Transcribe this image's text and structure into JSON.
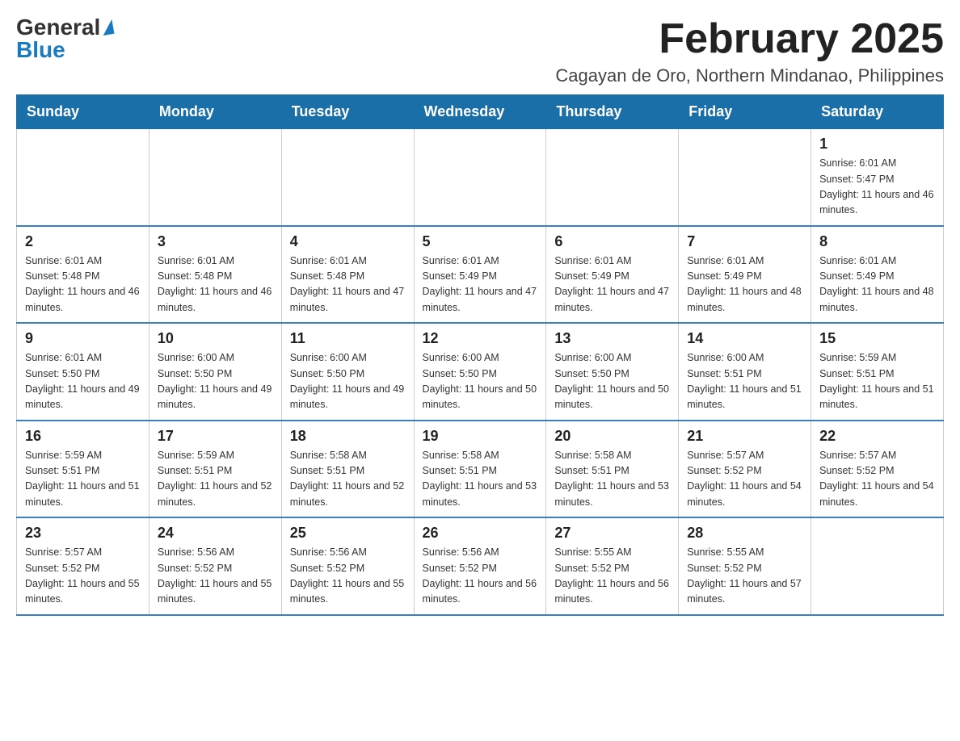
{
  "header": {
    "logo_general": "General",
    "logo_blue": "Blue",
    "month_title": "February 2025",
    "location": "Cagayan de Oro, Northern Mindanao, Philippines"
  },
  "days_of_week": [
    "Sunday",
    "Monday",
    "Tuesday",
    "Wednesday",
    "Thursday",
    "Friday",
    "Saturday"
  ],
  "weeks": [
    [
      {
        "day": "",
        "sunrise": "",
        "sunset": "",
        "daylight": ""
      },
      {
        "day": "",
        "sunrise": "",
        "sunset": "",
        "daylight": ""
      },
      {
        "day": "",
        "sunrise": "",
        "sunset": "",
        "daylight": ""
      },
      {
        "day": "",
        "sunrise": "",
        "sunset": "",
        "daylight": ""
      },
      {
        "day": "",
        "sunrise": "",
        "sunset": "",
        "daylight": ""
      },
      {
        "day": "",
        "sunrise": "",
        "sunset": "",
        "daylight": ""
      },
      {
        "day": "1",
        "sunrise": "Sunrise: 6:01 AM",
        "sunset": "Sunset: 5:47 PM",
        "daylight": "Daylight: 11 hours and 46 minutes."
      }
    ],
    [
      {
        "day": "2",
        "sunrise": "Sunrise: 6:01 AM",
        "sunset": "Sunset: 5:48 PM",
        "daylight": "Daylight: 11 hours and 46 minutes."
      },
      {
        "day": "3",
        "sunrise": "Sunrise: 6:01 AM",
        "sunset": "Sunset: 5:48 PM",
        "daylight": "Daylight: 11 hours and 46 minutes."
      },
      {
        "day": "4",
        "sunrise": "Sunrise: 6:01 AM",
        "sunset": "Sunset: 5:48 PM",
        "daylight": "Daylight: 11 hours and 47 minutes."
      },
      {
        "day": "5",
        "sunrise": "Sunrise: 6:01 AM",
        "sunset": "Sunset: 5:49 PM",
        "daylight": "Daylight: 11 hours and 47 minutes."
      },
      {
        "day": "6",
        "sunrise": "Sunrise: 6:01 AM",
        "sunset": "Sunset: 5:49 PM",
        "daylight": "Daylight: 11 hours and 47 minutes."
      },
      {
        "day": "7",
        "sunrise": "Sunrise: 6:01 AM",
        "sunset": "Sunset: 5:49 PM",
        "daylight": "Daylight: 11 hours and 48 minutes."
      },
      {
        "day": "8",
        "sunrise": "Sunrise: 6:01 AM",
        "sunset": "Sunset: 5:49 PM",
        "daylight": "Daylight: 11 hours and 48 minutes."
      }
    ],
    [
      {
        "day": "9",
        "sunrise": "Sunrise: 6:01 AM",
        "sunset": "Sunset: 5:50 PM",
        "daylight": "Daylight: 11 hours and 49 minutes."
      },
      {
        "day": "10",
        "sunrise": "Sunrise: 6:00 AM",
        "sunset": "Sunset: 5:50 PM",
        "daylight": "Daylight: 11 hours and 49 minutes."
      },
      {
        "day": "11",
        "sunrise": "Sunrise: 6:00 AM",
        "sunset": "Sunset: 5:50 PM",
        "daylight": "Daylight: 11 hours and 49 minutes."
      },
      {
        "day": "12",
        "sunrise": "Sunrise: 6:00 AM",
        "sunset": "Sunset: 5:50 PM",
        "daylight": "Daylight: 11 hours and 50 minutes."
      },
      {
        "day": "13",
        "sunrise": "Sunrise: 6:00 AM",
        "sunset": "Sunset: 5:50 PM",
        "daylight": "Daylight: 11 hours and 50 minutes."
      },
      {
        "day": "14",
        "sunrise": "Sunrise: 6:00 AM",
        "sunset": "Sunset: 5:51 PM",
        "daylight": "Daylight: 11 hours and 51 minutes."
      },
      {
        "day": "15",
        "sunrise": "Sunrise: 5:59 AM",
        "sunset": "Sunset: 5:51 PM",
        "daylight": "Daylight: 11 hours and 51 minutes."
      }
    ],
    [
      {
        "day": "16",
        "sunrise": "Sunrise: 5:59 AM",
        "sunset": "Sunset: 5:51 PM",
        "daylight": "Daylight: 11 hours and 51 minutes."
      },
      {
        "day": "17",
        "sunrise": "Sunrise: 5:59 AM",
        "sunset": "Sunset: 5:51 PM",
        "daylight": "Daylight: 11 hours and 52 minutes."
      },
      {
        "day": "18",
        "sunrise": "Sunrise: 5:58 AM",
        "sunset": "Sunset: 5:51 PM",
        "daylight": "Daylight: 11 hours and 52 minutes."
      },
      {
        "day": "19",
        "sunrise": "Sunrise: 5:58 AM",
        "sunset": "Sunset: 5:51 PM",
        "daylight": "Daylight: 11 hours and 53 minutes."
      },
      {
        "day": "20",
        "sunrise": "Sunrise: 5:58 AM",
        "sunset": "Sunset: 5:51 PM",
        "daylight": "Daylight: 11 hours and 53 minutes."
      },
      {
        "day": "21",
        "sunrise": "Sunrise: 5:57 AM",
        "sunset": "Sunset: 5:52 PM",
        "daylight": "Daylight: 11 hours and 54 minutes."
      },
      {
        "day": "22",
        "sunrise": "Sunrise: 5:57 AM",
        "sunset": "Sunset: 5:52 PM",
        "daylight": "Daylight: 11 hours and 54 minutes."
      }
    ],
    [
      {
        "day": "23",
        "sunrise": "Sunrise: 5:57 AM",
        "sunset": "Sunset: 5:52 PM",
        "daylight": "Daylight: 11 hours and 55 minutes."
      },
      {
        "day": "24",
        "sunrise": "Sunrise: 5:56 AM",
        "sunset": "Sunset: 5:52 PM",
        "daylight": "Daylight: 11 hours and 55 minutes."
      },
      {
        "day": "25",
        "sunrise": "Sunrise: 5:56 AM",
        "sunset": "Sunset: 5:52 PM",
        "daylight": "Daylight: 11 hours and 55 minutes."
      },
      {
        "day": "26",
        "sunrise": "Sunrise: 5:56 AM",
        "sunset": "Sunset: 5:52 PM",
        "daylight": "Daylight: 11 hours and 56 minutes."
      },
      {
        "day": "27",
        "sunrise": "Sunrise: 5:55 AM",
        "sunset": "Sunset: 5:52 PM",
        "daylight": "Daylight: 11 hours and 56 minutes."
      },
      {
        "day": "28",
        "sunrise": "Sunrise: 5:55 AM",
        "sunset": "Sunset: 5:52 PM",
        "daylight": "Daylight: 11 hours and 57 minutes."
      },
      {
        "day": "",
        "sunrise": "",
        "sunset": "",
        "daylight": ""
      }
    ]
  ]
}
